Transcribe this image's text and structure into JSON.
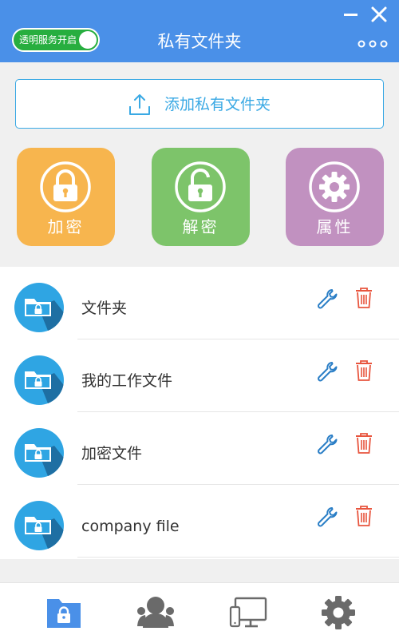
{
  "titlebar": {
    "title": "私有文件夹",
    "toggle_label": "透明服务开启",
    "toggle_on": true,
    "icons": [
      "minimize-icon",
      "close-icon",
      "more-icon"
    ]
  },
  "add_folder": {
    "label": "添加私有文件夹",
    "icon": "upload-icon"
  },
  "actions": [
    {
      "label": "加密",
      "icon": "lock-closed-icon",
      "color": "#f7b54e"
    },
    {
      "label": "解密",
      "icon": "lock-open-icon",
      "color": "#7dc46a"
    },
    {
      "label": "属性",
      "icon": "gear-icon",
      "color": "#c191c0"
    }
  ],
  "folders": [
    {
      "name": "文件夹"
    },
    {
      "name": "我的工作文件"
    },
    {
      "name": "加密文件"
    },
    {
      "name": "company file"
    }
  ],
  "bottom_nav": [
    {
      "icon": "private-folder-icon",
      "active": true
    },
    {
      "icon": "users-icon",
      "active": false
    },
    {
      "icon": "devices-icon",
      "active": false
    },
    {
      "icon": "settings-icon",
      "active": false
    }
  ],
  "colors": {
    "titlebar": "#4a90e8",
    "accent": "#3aa9e4",
    "toggle_on": "#27ae3f",
    "edit_icon": "#2a7ec6",
    "delete_icon": "#e8553e",
    "nav_active": "#4a90e8",
    "nav_inactive": "#6a6a6a"
  }
}
